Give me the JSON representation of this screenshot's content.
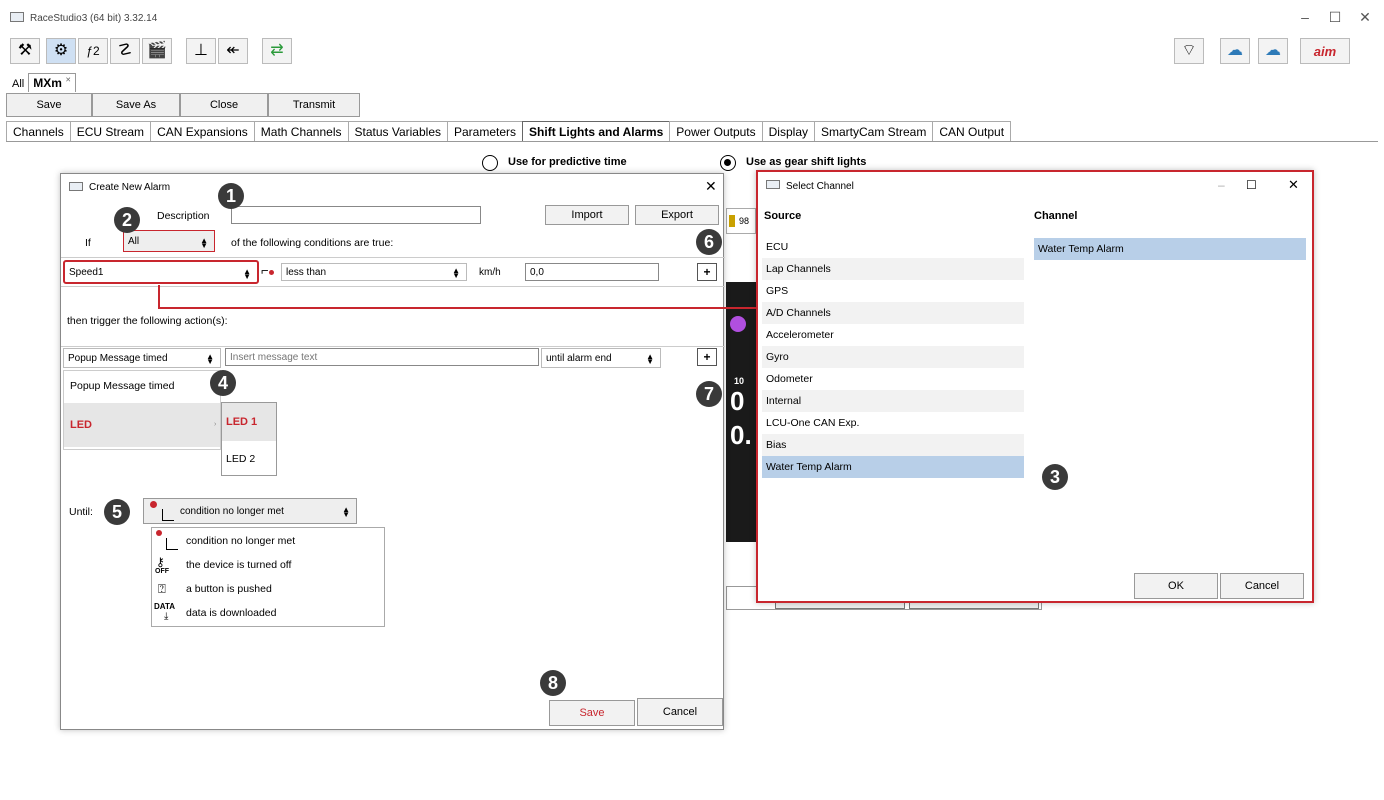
{
  "app": {
    "title": "RaceStudio3 (64 bit) 3.32.14",
    "win_min": "–",
    "win_max": "☐",
    "win_close": "✕"
  },
  "doc_tabs": {
    "all": "All",
    "active": "MXm",
    "close_glyph": "✕"
  },
  "actions": {
    "save": "Save",
    "save_as": "Save As",
    "close": "Close",
    "transmit": "Transmit"
  },
  "menu_tabs": [
    "Channels",
    "ECU Stream",
    "CAN Expansions",
    "Math Channels",
    "Status Variables",
    "Parameters",
    "Shift Lights and Alarms",
    "Power Outputs",
    "Display",
    "SmartyCam Stream",
    "CAN Output"
  ],
  "radios": {
    "predictive": "Use for predictive time",
    "gear_shift": "Use as gear shift lights"
  },
  "alarm_dialog": {
    "title": "Create New Alarm",
    "close": "✕",
    "description_label": "Description",
    "description_value": "",
    "import": "Import",
    "export": "Export",
    "if_label": "If",
    "if_value": "All",
    "conditions_text": "of the following conditions are true:",
    "channel": "Speed1",
    "operator": "less than",
    "unit": "km/h",
    "threshold": "0,0",
    "then_text": "then trigger the following action(s):",
    "action_value": "Popup Message timed",
    "message_placeholder": "Insert message text",
    "duration_value": "until alarm end",
    "action_menu": [
      "Popup Message timed",
      "LED"
    ],
    "led_submenu": [
      "LED 1",
      "LED 2"
    ],
    "until_label": "Until:",
    "until_value": "condition no longer met",
    "until_options": [
      "condition no longer met",
      "the device is turned off",
      "a button is pushed",
      "data is downloaded"
    ],
    "off_text": "OFF",
    "data_text": "DATA",
    "save": "Save",
    "cancel": "Cancel"
  },
  "select_dialog": {
    "title": "Select Channel",
    "source_header": "Source",
    "channel_header": "Channel",
    "sources": [
      "ECU",
      "Lap Channels",
      "GPS",
      "A/D Channels",
      "Accelerometer",
      "Gyro",
      "Odometer",
      "Internal",
      "LCU-One CAN Exp.",
      "Bias",
      "Water Temp Alarm"
    ],
    "selected_source": "Water Temp Alarm",
    "channels": [
      "Water Temp Alarm"
    ],
    "ok": "OK",
    "cancel": "Cancel"
  },
  "background": {
    "value_98": "98",
    "value_10": "10",
    "digit_a": "0",
    "digit_b": "0."
  },
  "callouts": [
    "1",
    "2",
    "3",
    "4",
    "5",
    "6",
    "7",
    "8"
  ],
  "colors": {
    "accent_red": "#c8262e",
    "selection_blue": "#b8cfe8",
    "callout_gray": "#3a3a3a"
  }
}
